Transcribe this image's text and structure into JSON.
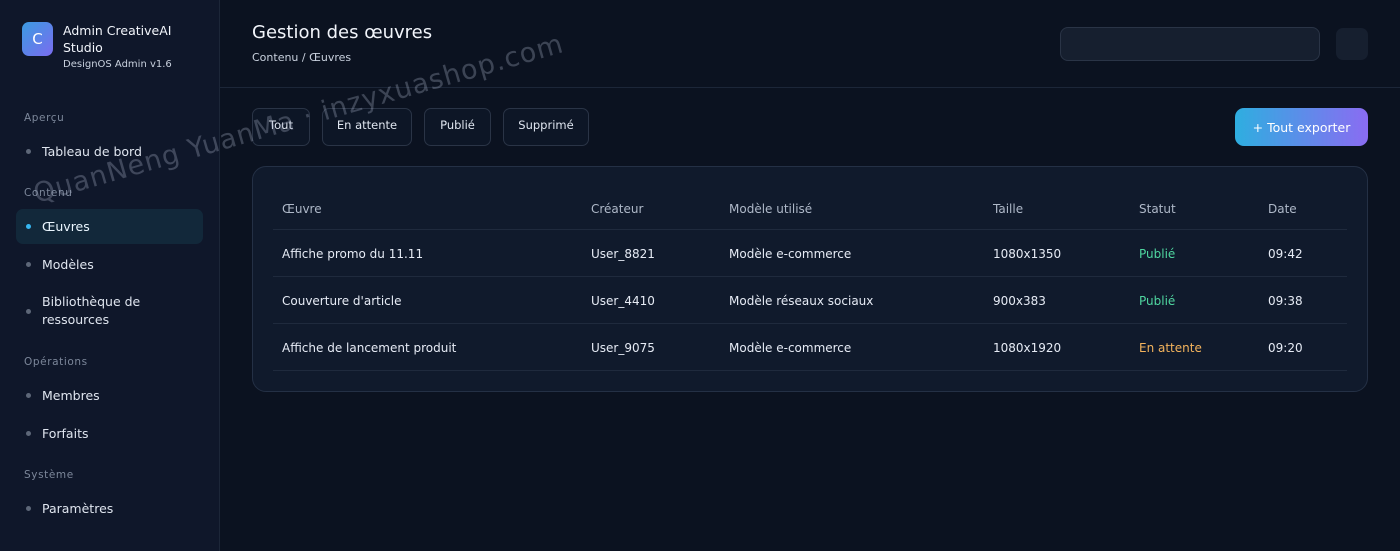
{
  "brand": {
    "logo_letter": "C",
    "name": "Admin CreativeAI Studio",
    "subtitle": "DesignOS Admin v1.6"
  },
  "sidebar": {
    "sections": [
      {
        "label": "Aperçu",
        "items": [
          {
            "label": "Tableau de bord",
            "active": false
          }
        ]
      },
      {
        "label": "Contenu",
        "items": [
          {
            "label": "Œuvres",
            "active": true
          },
          {
            "label": "Modèles",
            "active": false
          },
          {
            "label": "Bibliothèque de ressources",
            "active": false
          }
        ]
      },
      {
        "label": "Opérations",
        "items": [
          {
            "label": "Membres",
            "active": false
          },
          {
            "label": "Forfaits",
            "active": false
          }
        ]
      },
      {
        "label": "Système",
        "items": [
          {
            "label": "Paramètres",
            "active": false
          }
        ]
      }
    ]
  },
  "header": {
    "title": "Gestion des œuvres",
    "breadcrumb": "Contenu / Œuvres",
    "search_value": ""
  },
  "filters": {
    "all": "Tout",
    "pending": "En attente",
    "published": "Publié",
    "deleted": "Supprimé"
  },
  "export_label": "+ Tout exporter",
  "table": {
    "columns": [
      "Œuvre",
      "Créateur",
      "Modèle utilisé",
      "Taille",
      "Statut",
      "Date"
    ],
    "rows": [
      [
        "Affiche promo du 11.11",
        "User_8821",
        "Modèle e-commerce",
        "1080x1350",
        "Publié",
        "09:42"
      ],
      [
        "Couverture d'article",
        "User_4410",
        "Modèle réseaux sociaux",
        "900x383",
        "Publié",
        "09:38"
      ],
      [
        "Affiche de lancement produit",
        "User_9075",
        "Modèle e-commerce",
        "1080x1920",
        "En attente",
        "09:20"
      ]
    ]
  },
  "colors": {
    "accent": "#36b6f0",
    "published": "#4fd6a0",
    "pending": "#f3b35c"
  },
  "watermark": "QuanNeng YuanMa · inzyxuashop.com"
}
